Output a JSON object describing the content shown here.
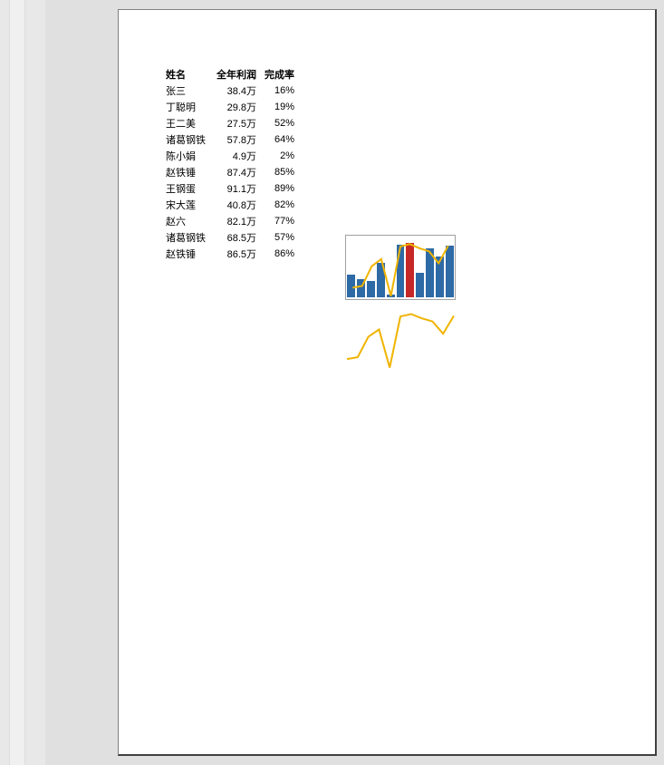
{
  "table": {
    "headers": {
      "name": "姓名",
      "profit": "全年利润",
      "rate": "完成率"
    },
    "rows": [
      {
        "name": "张三",
        "profit": "38.4万",
        "rate": "16%"
      },
      {
        "name": "丁聪明",
        "profit": "29.8万",
        "rate": "19%"
      },
      {
        "name": "王二美",
        "profit": "27.5万",
        "rate": "52%"
      },
      {
        "name": "诸葛钢铁",
        "profit": "57.8万",
        "rate": "64%"
      },
      {
        "name": "陈小娟",
        "profit": "4.9万",
        "rate": "2%"
      },
      {
        "name": "赵铁锤",
        "profit": "87.4万",
        "rate": "85%"
      },
      {
        "name": "王钢蛋",
        "profit": "91.1万",
        "rate": "89%"
      },
      {
        "name": "宋大莲",
        "profit": "40.8万",
        "rate": "82%"
      },
      {
        "name": "赵六",
        "profit": "82.1万",
        "rate": "77%"
      },
      {
        "name": "诸葛钢铁",
        "profit": "68.5万",
        "rate": "57%"
      },
      {
        "name": "赵铁锤",
        "profit": "86.5万",
        "rate": "86%"
      }
    ]
  },
  "chart_data": [
    {
      "type": "bar",
      "title": "",
      "xlabel": "",
      "ylabel": "",
      "ylim": [
        0,
        100
      ],
      "categories": [
        "张三",
        "丁聪明",
        "王二美",
        "诸葛钢铁",
        "陈小娟",
        "赵铁锤",
        "王钢蛋",
        "宋大莲",
        "赵六",
        "诸葛钢铁",
        "赵铁锤"
      ],
      "values": [
        38.4,
        29.8,
        27.5,
        57.8,
        4.9,
        87.4,
        91.1,
        40.8,
        82.1,
        68.5,
        86.5
      ],
      "highlight_index": 6,
      "overlay_line": {
        "type": "line",
        "values": [
          16,
          19,
          52,
          64,
          2,
          85,
          89,
          82,
          77,
          57,
          86
        ]
      }
    },
    {
      "type": "line",
      "title": "",
      "xlabel": "",
      "ylabel": "",
      "ylim": [
        0,
        100
      ],
      "categories": [
        "张三",
        "丁聪明",
        "王二美",
        "诸葛钢铁",
        "陈小娟",
        "赵铁锤",
        "王钢蛋",
        "宋大莲",
        "赵六",
        "诸葛钢铁",
        "赵铁锤"
      ],
      "values": [
        16,
        19,
        52,
        64,
        2,
        85,
        89,
        82,
        77,
        57,
        86
      ]
    }
  ]
}
